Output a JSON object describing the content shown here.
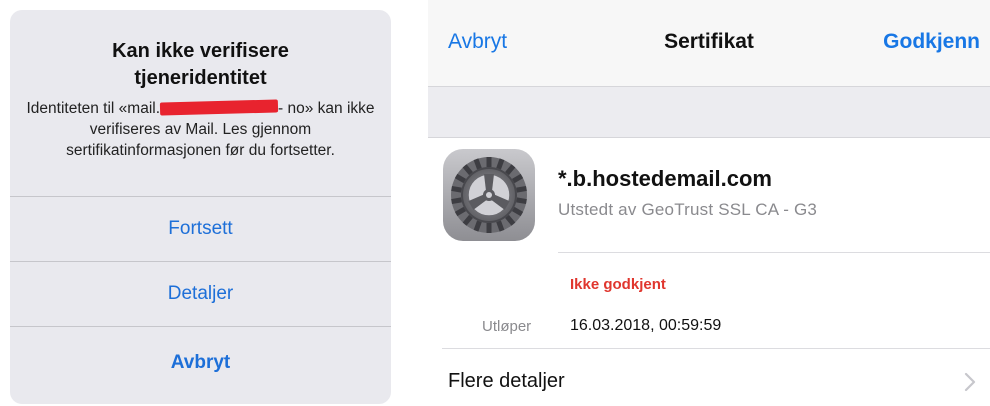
{
  "alert": {
    "title_line1": "Kan ikke verifisere",
    "title_line2": "tjeneridentitet",
    "message": {
      "part1": "Identiteten til «mail.",
      "part2": "-",
      "part3": "no» kan ikke verifiseres av Mail. Les gjennom sertifikatinformasjonen før du fortsetter."
    },
    "buttons": {
      "continue": "Fortsett",
      "details": "Detaljer",
      "cancel": "Avbryt"
    }
  },
  "certificate_sheet": {
    "nav": {
      "cancel": "Avbryt",
      "title": "Sertifikat",
      "accept": "Godkjenn"
    },
    "cert": {
      "name": "*.b.hostedemail.com",
      "issuer": "Utstedt av GeoTrust SSL CA - G3",
      "icon": "settings-gear-icon"
    },
    "status": "Ikke godkjent",
    "expires_label": "Utløper",
    "expires_value": "16.03.2018, 00:59:59",
    "more_details": "Flere detaljer"
  },
  "colors": {
    "ios_blue": "#1877e5",
    "alert_blue": "#1d6fd8",
    "status_red": "#e0362e",
    "redaction_red": "#e8232e"
  }
}
